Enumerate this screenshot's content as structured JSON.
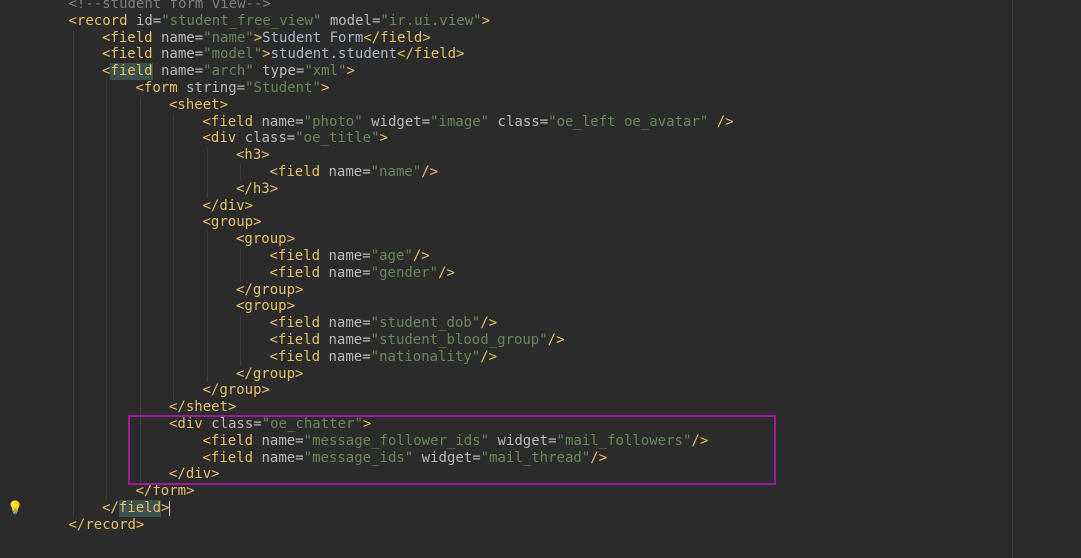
{
  "editor": {
    "language": "xml",
    "lines": [
      {
        "indent": 2,
        "tokens": [
          {
            "t": "cmt",
            "v": "<!--student form view-->"
          }
        ]
      },
      {
        "indent": 2,
        "tokens": [
          {
            "t": "tag",
            "v": "<record"
          },
          {
            "t": "attr",
            "v": " id="
          },
          {
            "t": "str",
            "v": "\"student_free_view\""
          },
          {
            "t": "attr",
            "v": " model="
          },
          {
            "t": "str",
            "v": "\"ir.ui.view\""
          },
          {
            "t": "tag",
            "v": ">"
          }
        ]
      },
      {
        "indent": 3,
        "tokens": [
          {
            "t": "tag",
            "v": "<field"
          },
          {
            "t": "attr",
            "v": " name="
          },
          {
            "t": "str",
            "v": "\"name\""
          },
          {
            "t": "tag",
            "v": ">"
          },
          {
            "t": "txt",
            "v": "Student Form"
          },
          {
            "t": "tag",
            "v": "</field>"
          }
        ]
      },
      {
        "indent": 3,
        "tokens": [
          {
            "t": "tag",
            "v": "<field"
          },
          {
            "t": "attr",
            "v": " name="
          },
          {
            "t": "str",
            "v": "\"model\""
          },
          {
            "t": "tag",
            "v": ">"
          },
          {
            "t": "txt",
            "v": "student.student"
          },
          {
            "t": "tag",
            "v": "</field>"
          }
        ]
      },
      {
        "indent": 3,
        "tokens": [
          {
            "t": "tag",
            "v": "<"
          },
          {
            "t": "hl-tag",
            "v": "field"
          },
          {
            "t": "attr",
            "v": " name="
          },
          {
            "t": "str",
            "v": "\"arch\""
          },
          {
            "t": "attr",
            "v": " type="
          },
          {
            "t": "str",
            "v": "\"xml\""
          },
          {
            "t": "tag",
            "v": ">"
          }
        ]
      },
      {
        "indent": 4,
        "tokens": [
          {
            "t": "tag",
            "v": "<form"
          },
          {
            "t": "attr",
            "v": " string="
          },
          {
            "t": "str",
            "v": "\"Student\""
          },
          {
            "t": "tag",
            "v": ">"
          }
        ]
      },
      {
        "indent": 5,
        "tokens": [
          {
            "t": "tag",
            "v": "<sheet>"
          }
        ]
      },
      {
        "indent": 6,
        "tokens": [
          {
            "t": "tag",
            "v": "<field"
          },
          {
            "t": "attr",
            "v": " name="
          },
          {
            "t": "str",
            "v": "\"photo\""
          },
          {
            "t": "attr",
            "v": " widget="
          },
          {
            "t": "str",
            "v": "\"image\""
          },
          {
            "t": "attr",
            "v": " class="
          },
          {
            "t": "str",
            "v": "\"oe_left oe_avatar\""
          },
          {
            "t": "tag",
            "v": " />"
          }
        ]
      },
      {
        "indent": 6,
        "tokens": [
          {
            "t": "tag",
            "v": "<div"
          },
          {
            "t": "attr",
            "v": " class="
          },
          {
            "t": "str",
            "v": "\"oe_title\""
          },
          {
            "t": "tag",
            "v": ">"
          }
        ]
      },
      {
        "indent": 7,
        "tokens": [
          {
            "t": "tag",
            "v": "<h3>"
          }
        ]
      },
      {
        "indent": 8,
        "tokens": [
          {
            "t": "tag",
            "v": "<field"
          },
          {
            "t": "attr",
            "v": " name="
          },
          {
            "t": "str",
            "v": "\"name\""
          },
          {
            "t": "tag",
            "v": "/>"
          }
        ]
      },
      {
        "indent": 7,
        "tokens": [
          {
            "t": "tag",
            "v": "</h3>"
          }
        ]
      },
      {
        "indent": 6,
        "tokens": [
          {
            "t": "tag",
            "v": "</div>"
          }
        ]
      },
      {
        "indent": 6,
        "tokens": [
          {
            "t": "tag",
            "v": "<group>"
          }
        ]
      },
      {
        "indent": 7,
        "tokens": [
          {
            "t": "tag",
            "v": "<group>"
          }
        ]
      },
      {
        "indent": 8,
        "tokens": [
          {
            "t": "tag",
            "v": "<field"
          },
          {
            "t": "attr",
            "v": " name="
          },
          {
            "t": "str",
            "v": "\"age\""
          },
          {
            "t": "tag",
            "v": "/>"
          }
        ]
      },
      {
        "indent": 8,
        "tokens": [
          {
            "t": "tag",
            "v": "<field"
          },
          {
            "t": "attr",
            "v": " name="
          },
          {
            "t": "str",
            "v": "\"gender\""
          },
          {
            "t": "tag",
            "v": "/>"
          }
        ]
      },
      {
        "indent": 7,
        "tokens": [
          {
            "t": "tag",
            "v": "</group>"
          }
        ]
      },
      {
        "indent": 7,
        "tokens": [
          {
            "t": "tag",
            "v": "<group>"
          }
        ]
      },
      {
        "indent": 8,
        "tokens": [
          {
            "t": "tag",
            "v": "<field"
          },
          {
            "t": "attr",
            "v": " name="
          },
          {
            "t": "str",
            "v": "\"student_dob\""
          },
          {
            "t": "tag",
            "v": "/>"
          }
        ]
      },
      {
        "indent": 8,
        "tokens": [
          {
            "t": "tag",
            "v": "<field"
          },
          {
            "t": "attr",
            "v": " name="
          },
          {
            "t": "str",
            "v": "\"student_blood_group\""
          },
          {
            "t": "tag",
            "v": "/>"
          }
        ]
      },
      {
        "indent": 8,
        "tokens": [
          {
            "t": "tag",
            "v": "<field"
          },
          {
            "t": "attr",
            "v": " name="
          },
          {
            "t": "str",
            "v": "\"nationality\""
          },
          {
            "t": "tag",
            "v": "/>"
          }
        ]
      },
      {
        "indent": 7,
        "tokens": [
          {
            "t": "tag",
            "v": "</group>"
          }
        ]
      },
      {
        "indent": 6,
        "tokens": [
          {
            "t": "tag",
            "v": "</group>"
          }
        ]
      },
      {
        "indent": 5,
        "tokens": [
          {
            "t": "tag",
            "v": "</sheet>"
          }
        ]
      },
      {
        "indent": 5,
        "tokens": [
          {
            "t": "tag",
            "v": "<div"
          },
          {
            "t": "attr",
            "v": " class="
          },
          {
            "t": "str",
            "v": "\"oe_chatter\""
          },
          {
            "t": "tag",
            "v": ">"
          }
        ]
      },
      {
        "indent": 6,
        "tokens": [
          {
            "t": "tag",
            "v": "<field"
          },
          {
            "t": "attr",
            "v": " name="
          },
          {
            "t": "str",
            "v": "\"message_follower_ids\""
          },
          {
            "t": "attr",
            "v": " widget="
          },
          {
            "t": "str",
            "v": "\"mail_followers\""
          },
          {
            "t": "tag",
            "v": "/>"
          }
        ]
      },
      {
        "indent": 6,
        "tokens": [
          {
            "t": "tag",
            "v": "<field"
          },
          {
            "t": "attr",
            "v": " name="
          },
          {
            "t": "str",
            "v": "\"message_ids\""
          },
          {
            "t": "attr",
            "v": " widget="
          },
          {
            "t": "str",
            "v": "\"mail_thread\""
          },
          {
            "t": "tag",
            "v": "/>"
          }
        ]
      },
      {
        "indent": 5,
        "tokens": [
          {
            "t": "tag",
            "v": "</div>"
          }
        ]
      },
      {
        "indent": 4,
        "tokens": [
          {
            "t": "tag",
            "v": "</form>"
          }
        ]
      },
      {
        "indent": 3,
        "tokens": [
          {
            "t": "tag",
            "v": "</"
          },
          {
            "t": "hl-tag",
            "v": "field"
          },
          {
            "t": "tag",
            "v": ">"
          }
        ],
        "caret": true
      },
      {
        "indent": 2,
        "tokens": [
          {
            "t": "tag",
            "v": "</record>"
          }
        ]
      }
    ]
  },
  "gutter": {
    "bulb_icon": "lightbulb-icon",
    "bulb_glyph": "💡"
  },
  "annotation": {
    "color": "#9b1d9e"
  }
}
